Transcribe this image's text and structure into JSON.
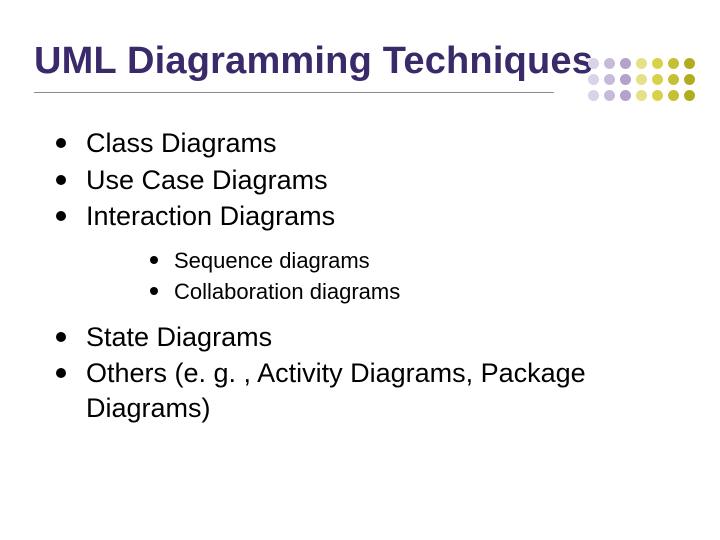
{
  "title": "UML Diagramming Techniques",
  "bullets": {
    "b0": "Class Diagrams",
    "b1": "Use Case Diagrams",
    "b2": "Interaction Diagrams",
    "b2_sub0": "Sequence diagrams",
    "b2_sub1": "Collaboration diagrams",
    "b3": "State Diagrams",
    "b4": "Others (e. g. , Activity Diagrams, Package Diagrams)"
  }
}
